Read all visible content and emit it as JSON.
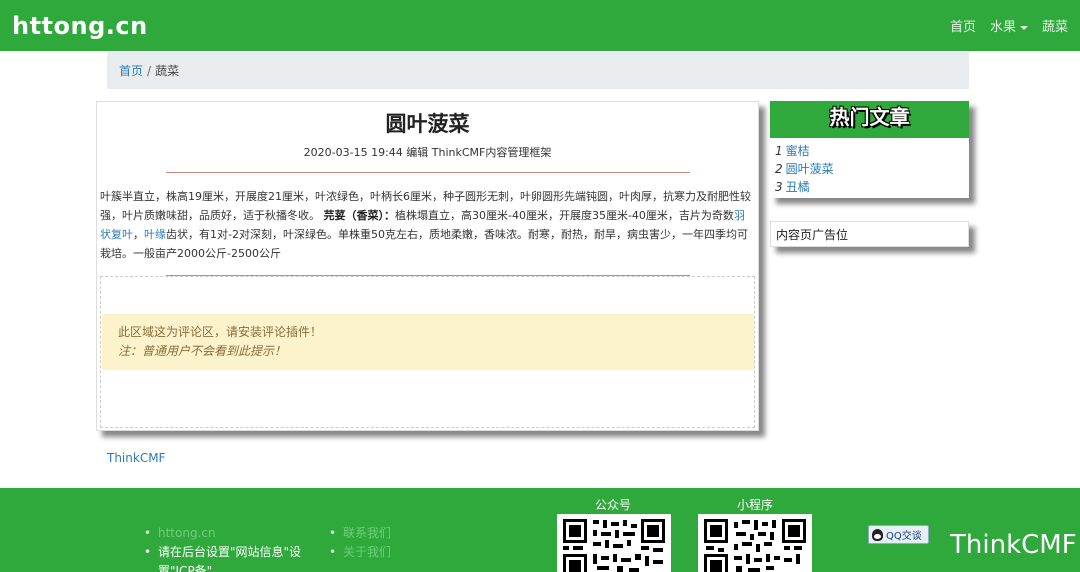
{
  "brand": "httong.cn",
  "nav": {
    "home": "首页",
    "fruit": "水果",
    "veg": "蔬菜"
  },
  "breadcrumb": {
    "home": "首页",
    "sep": "/",
    "current": "蔬菜"
  },
  "article": {
    "title": "圆叶菠菜",
    "meta": "2020-03-15 19:44 编辑 ThinkCMF内容管理框架",
    "p1": "叶簇半直立，株高19厘米，开展度21厘米，叶浓绿色，叶柄长6厘米，种子圆形无刺，叶卵圆形先端钝圆，叶肉厚，抗寒力及耐肥性较强，叶片质嫩味甜，品质好，适于秋播冬收。",
    "bold": "芫荽（香菜）：",
    "p2": "植株塌直立，高30厘米-40厘米，开展度35厘米-40厘米，吉片为奇数",
    "link1": "羽状复叶",
    "comma": "，",
    "link2": "叶缘",
    "p3": "齿状，有1对-2对深刻，叶深绿色。单株重50克左右，质地柔嫩，香味浓。耐寒，耐热，耐旱，病虫害少，一年四季均可栽培。一般亩产2000公斤-2500公斤"
  },
  "comment": {
    "line1": "此区域这为评论区，请安装评论插件！",
    "line2": "注：普通用户不会看到此提示！"
  },
  "sidebar": {
    "hot_title": "热门文章",
    "items": [
      {
        "num": "1",
        "label": "蜜桔"
      },
      {
        "num": "2",
        "label": "圆叶菠菜"
      },
      {
        "num": "3",
        "label": "丑橘"
      }
    ],
    "ad": "内容页广告位"
  },
  "footer_link": "ThinkCMF",
  "footer": {
    "list1": [
      "httong.cn",
      "请在后台设置\"网站信息\"设置\"ICP备\""
    ],
    "list2": [
      "联系我们",
      "关于我们"
    ],
    "qr1_label": "公众号",
    "qr2_label": "小程序",
    "qq": "QQ交谈",
    "watermark": "ThinkCMF"
  },
  "colors": {
    "primary": "#2fa83c",
    "breadcrumb_bg": "#e9ecef",
    "alert_bg": "#fcf3cd",
    "link": "#2b7bb9"
  }
}
